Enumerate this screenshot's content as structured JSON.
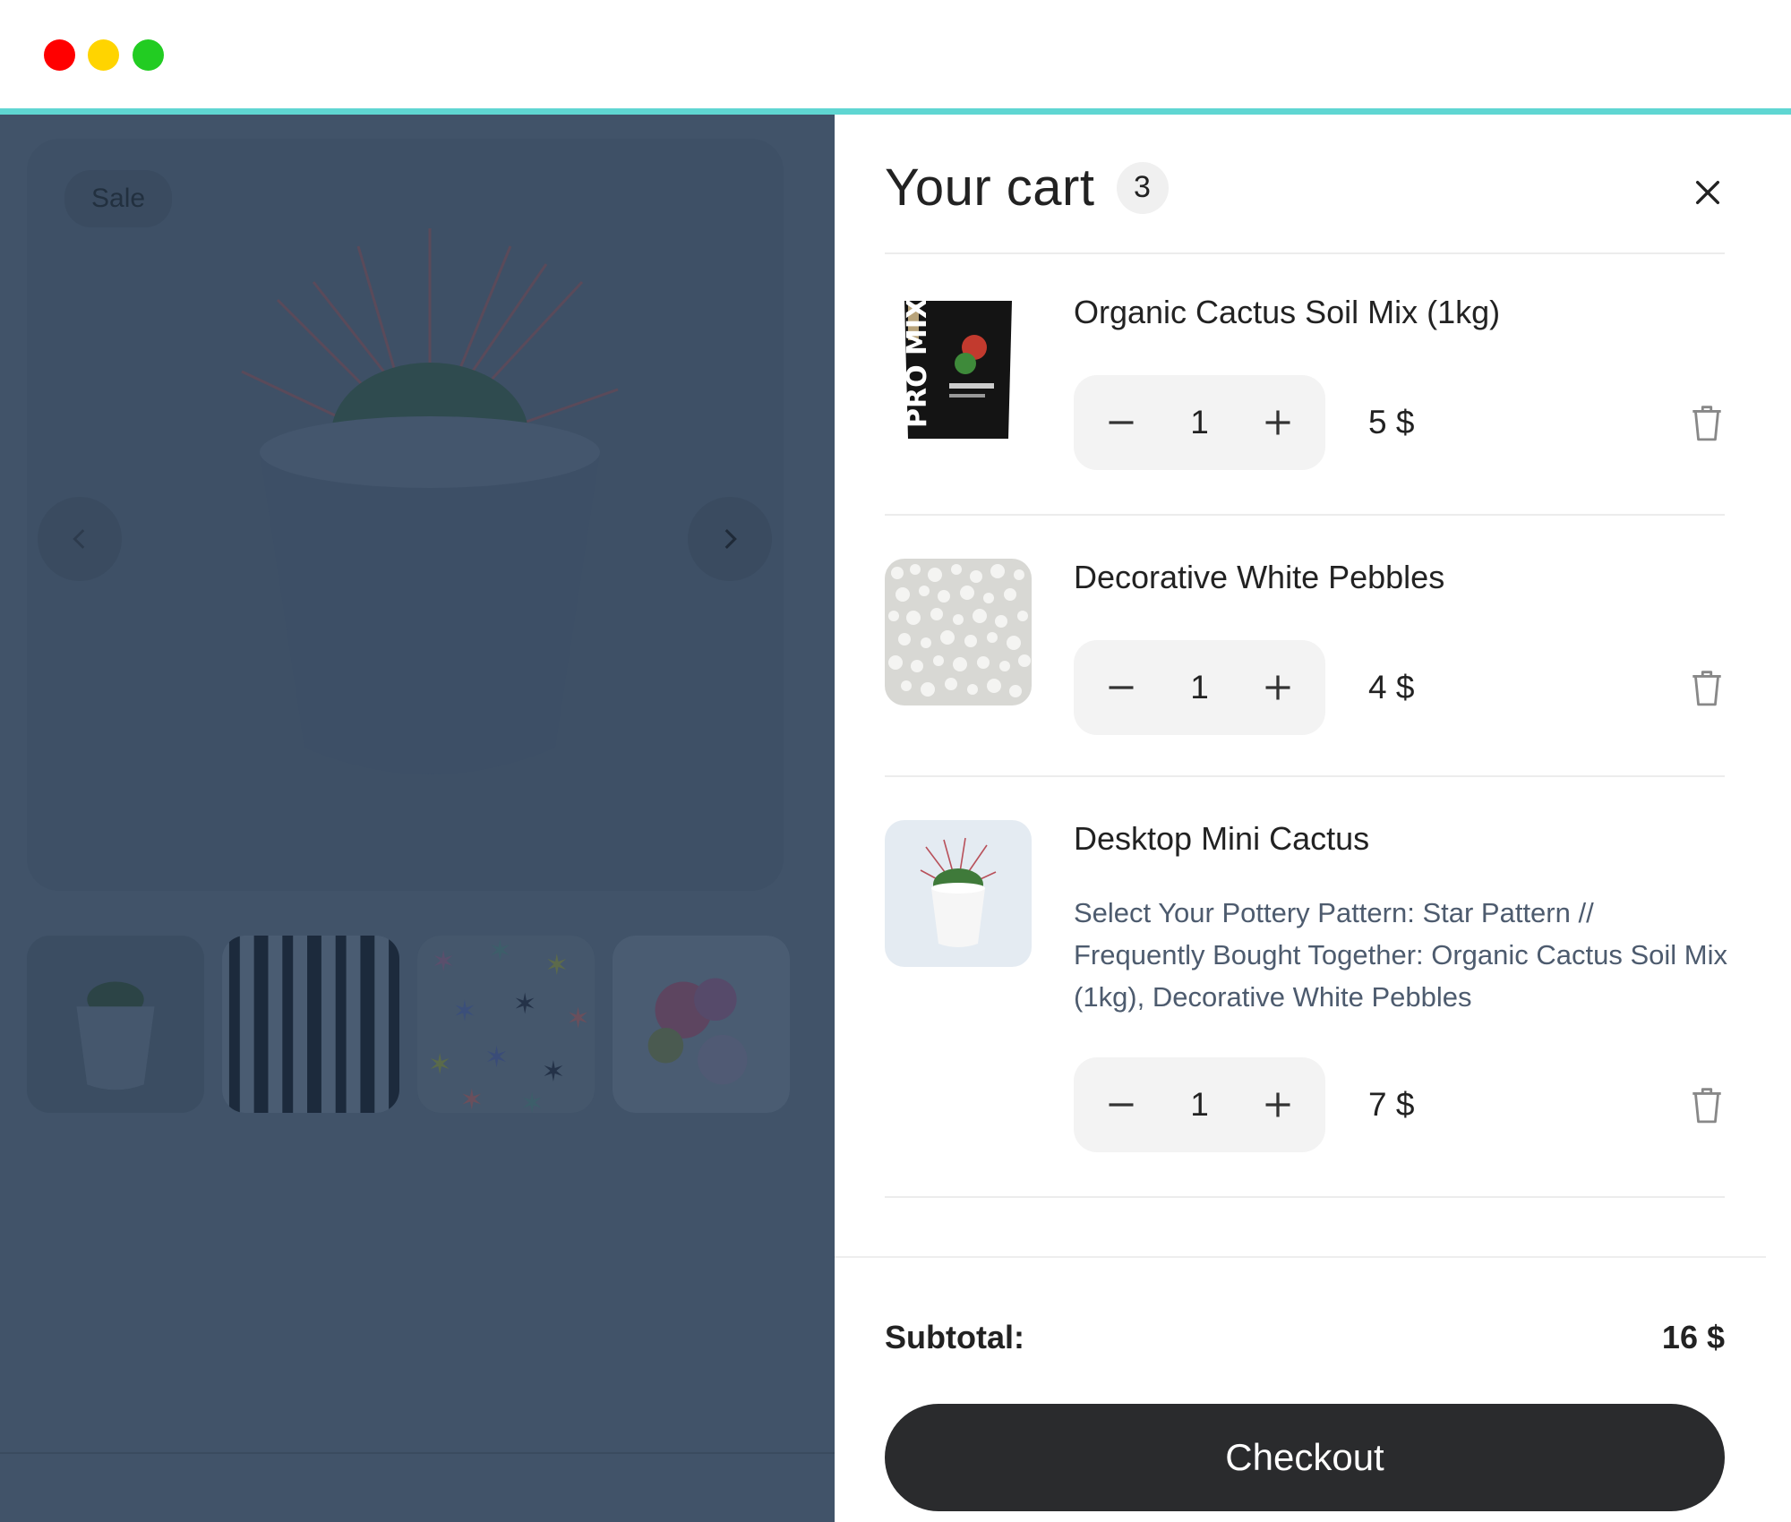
{
  "window": {
    "controls": [
      "close",
      "minimize",
      "maximize"
    ]
  },
  "colors": {
    "accent_line": "#5fd6d2",
    "overlay": "#415369",
    "checkout_bg": "#2a2b2d"
  },
  "product_page": {
    "badge": "Sale",
    "prev_icon": "chevron-left-icon",
    "next_icon": "chevron-right-icon",
    "thumbnails": [
      "cactus-pot",
      "stripe-pattern",
      "star-pattern",
      "floral-pattern"
    ]
  },
  "cart": {
    "title": "Your cart",
    "count": "3",
    "close_icon": "close-icon",
    "items": [
      {
        "name": "Organic Cactus Soil Mix (1kg)",
        "qty": "1",
        "price": "5 $",
        "options": ""
      },
      {
        "name": "Decorative White Pebbles",
        "qty": "1",
        "price": "4 $",
        "options": ""
      },
      {
        "name": "Desktop Mini Cactus",
        "qty": "1",
        "price": "7 $",
        "options_line1": "Select Your Pottery Pattern: Star Pattern  //",
        "options_line2": "Frequently Bought Together: Organic Cactus Soil Mix (1kg), Decorative White Pebbles"
      }
    ],
    "subtotal_label": "Subtotal:",
    "subtotal_value": "16 $",
    "checkout_label": "Checkout"
  }
}
